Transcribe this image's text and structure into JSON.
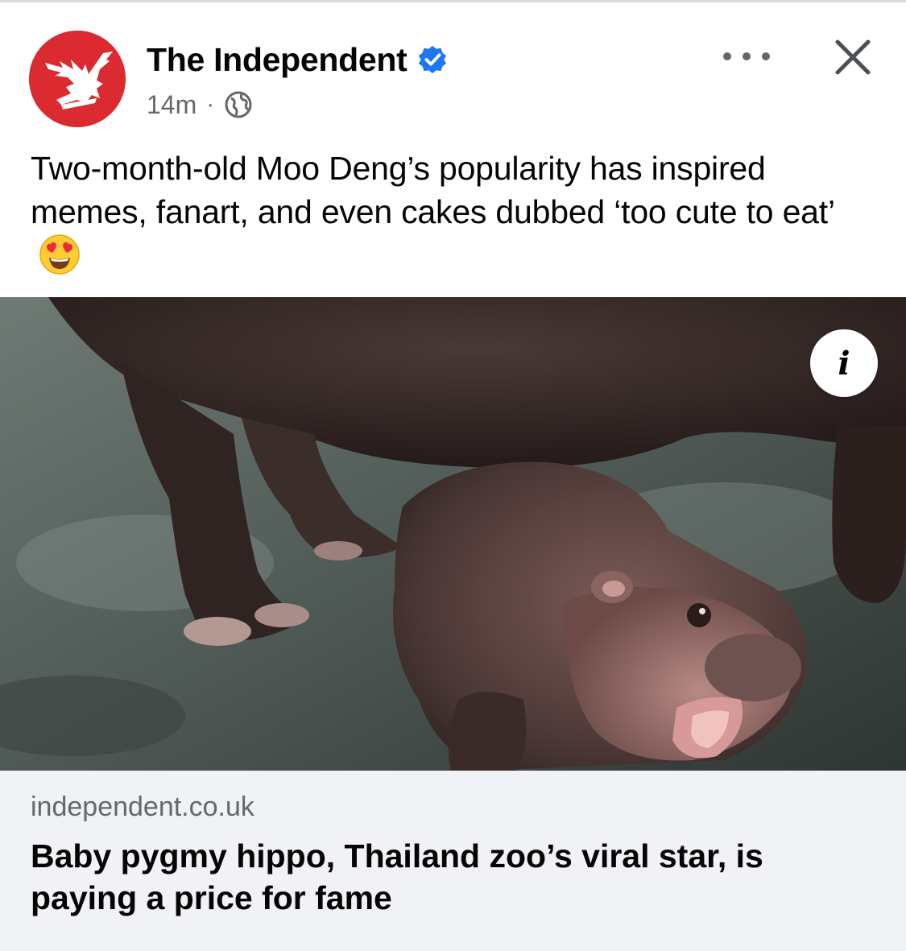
{
  "post": {
    "page_name": "The Independent",
    "verified": true,
    "time": "14m",
    "meta_separator": "·",
    "audience_icon": "globe-icon",
    "caption": "Two-month-old Moo Deng’s popularity has inspired memes, fanart, and even cakes dubbed ‘too cute to eat’",
    "caption_emoji": "smiling-face-with-heart-eyes-icon"
  },
  "actions": {
    "more_icon": "more-options-icon",
    "close_icon": "close-icon"
  },
  "media": {
    "info_label": "i"
  },
  "link": {
    "domain": "independent.co.uk",
    "title": "Baby pygmy hippo, Thailand zoo’s viral star, is paying a price for fame"
  },
  "colors": {
    "brand_red": "#db2b30",
    "verified_blue": "#1d77f2",
    "secondary_text": "#65676b",
    "link_card_bg": "#f0f2f5"
  }
}
